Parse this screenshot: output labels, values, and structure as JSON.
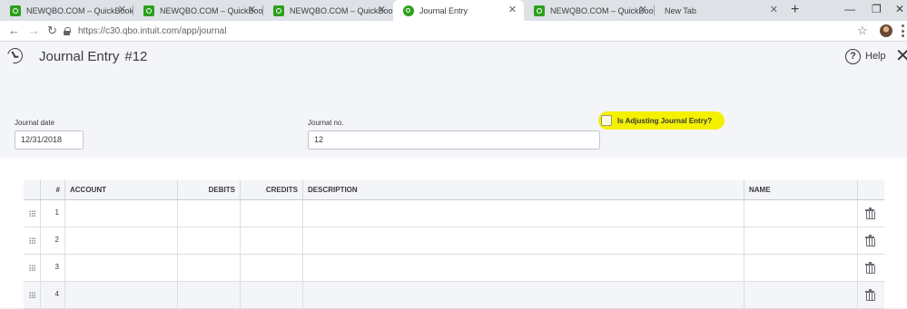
{
  "browser": {
    "tabs": [
      {
        "title": "NEWQBO.COM – QuickBooks",
        "icon": "quickbooks-icon",
        "active": false
      },
      {
        "title": "NEWQBO.COM – QuickBooks",
        "icon": "quickbooks-icon",
        "active": false
      },
      {
        "title": "NEWQBO.COM – QuickBooks",
        "icon": "quickbooks-icon",
        "active": false
      },
      {
        "title": "Journal Entry",
        "icon": "quickbooks-circle-icon",
        "active": true
      },
      {
        "title": "NEWQBO.COM – QuickBooks",
        "icon": "quickbooks-icon",
        "active": false
      },
      {
        "title": "New Tab",
        "icon": "",
        "active": false
      }
    ],
    "url": "https://c30.qbo.intuit.com/app/journal"
  },
  "header": {
    "title": "Journal Entry",
    "number": "#12",
    "help_label": "Help"
  },
  "form": {
    "journal_date_label": "Journal date",
    "journal_date_value": "12/31/2018",
    "journal_no_label": "Journal no.",
    "journal_no_value": "12",
    "adjusting_label": "Is Adjusting Journal Entry?",
    "adjusting_checked": false,
    "highlight_color": "#f3f000"
  },
  "grid": {
    "columns": {
      "index": "#",
      "account": "ACCOUNT",
      "debits": "DEBITS",
      "credits": "CREDITS",
      "description": "DESCRIPTION",
      "name": "NAME"
    },
    "rows": [
      {
        "index": "1"
      },
      {
        "index": "2"
      },
      {
        "index": "3"
      },
      {
        "index": "4"
      }
    ]
  },
  "colors": {
    "page_bg": "#f4f5f8",
    "text": "#393a3d",
    "brand_green": "#2ca01c"
  }
}
